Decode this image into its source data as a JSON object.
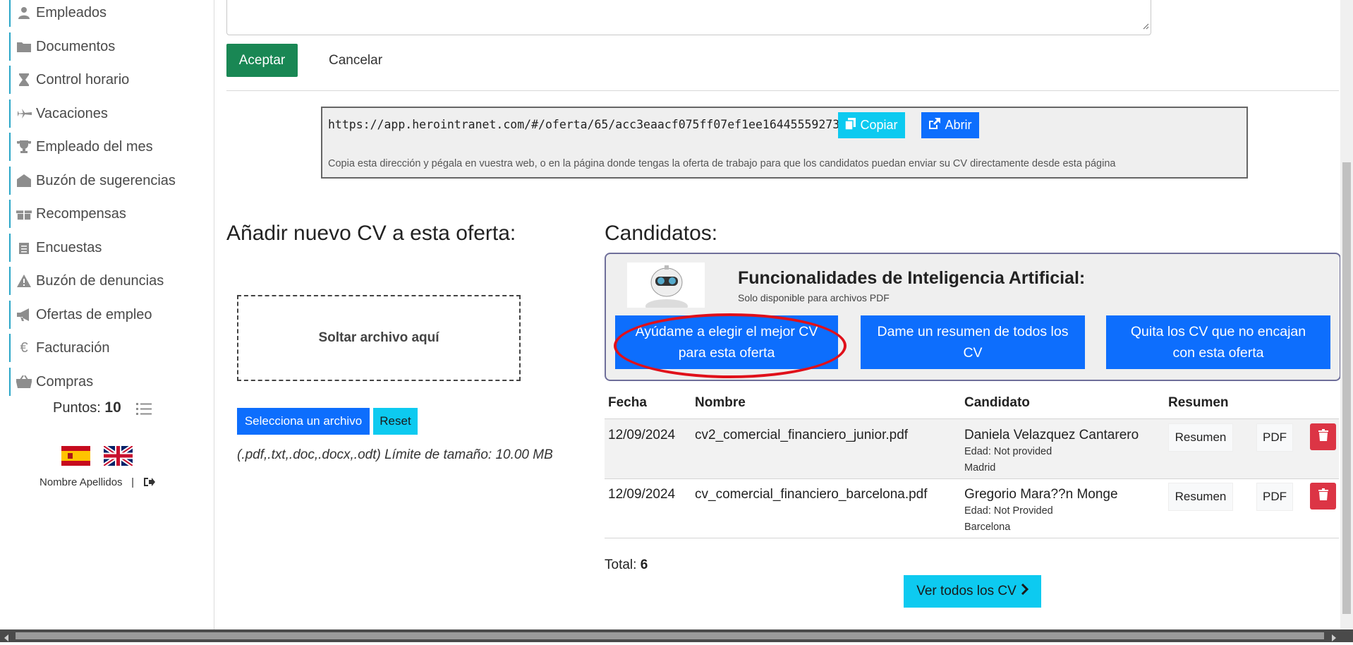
{
  "sidebar": {
    "items": [
      {
        "label": "Empleados",
        "icon": "user-icon"
      },
      {
        "label": "Documentos",
        "icon": "folder-icon"
      },
      {
        "label": "Control horario",
        "icon": "hourglass-icon"
      },
      {
        "label": "Vacaciones",
        "icon": "plane-icon"
      },
      {
        "label": "Empleado del mes",
        "icon": "trophy-icon"
      },
      {
        "label": "Buzón de sugerencias",
        "icon": "envelope-open-icon"
      },
      {
        "label": "Recompensas",
        "icon": "gift-icon"
      },
      {
        "label": "Encuestas",
        "icon": "clipboard-icon"
      },
      {
        "label": "Buzón de denuncias",
        "icon": "warning-icon"
      },
      {
        "label": "Ofertas de empleo",
        "icon": "megaphone-icon"
      },
      {
        "label": "Facturación",
        "icon": "euro-icon"
      },
      {
        "label": "Compras",
        "icon": "basket-icon"
      }
    ],
    "points_label": "Puntos:",
    "points_value": "10",
    "username": "Nombre Apellidos",
    "separator": "|"
  },
  "form": {
    "accept_label": "Aceptar",
    "cancel_label": "Cancelar"
  },
  "share": {
    "url": "https://app.herointranet.com/#/oferta/65/acc3eaacf075ff07ef1ee16445559273",
    "copy_label": "Copiar",
    "open_label": "Abrir",
    "help": "Copia esta dirección y pégala en vuestra web, o en la página donde tengas la oferta de trabajo para que los candidatos puedan enviar su CV directamente desde esta página"
  },
  "upload": {
    "heading": "Añadir nuevo CV a esta oferta:",
    "drop_text": "Soltar archivo aquí",
    "select_label": "Selecciona un archivo",
    "reset_label": "Reset",
    "limits": "(.pdf,.txt,.doc,.docx,.odt) Límite de tamaño: 10.00 MB"
  },
  "candidates": {
    "heading": "Candidatos:",
    "ai": {
      "title": "Funcionalidades de Inteligencia Artificial:",
      "subtitle": "Solo disponible para archivos PDF",
      "btn_best": [
        "Ayúdame a elegir el mejor CV",
        "para esta oferta"
      ],
      "btn_summary": [
        "Dame un resumen de todos los",
        "CV"
      ],
      "btn_filter": [
        "Quita los CV que no encajan",
        "con esta oferta"
      ]
    },
    "columns": {
      "fecha": "Fecha",
      "nombre": "Nombre",
      "candidato": "Candidato",
      "resumen": "Resumen"
    },
    "rows": [
      {
        "fecha": "12/09/2024",
        "nombre": "cv2_comercial_financiero_junior.pdf",
        "candidato": "Daniela Velazquez Cantarero",
        "edad": "Edad: Not provided",
        "ciudad": "Madrid",
        "resumen_label": "Resumen",
        "pdf_label": "PDF"
      },
      {
        "fecha": "12/09/2024",
        "nombre": "cv_comercial_financiero_barcelona.pdf",
        "candidato": "Gregorio Mara??n Monge",
        "edad": "Edad: Not Provided",
        "ciudad": "Barcelona",
        "resumen_label": "Resumen",
        "pdf_label": "PDF"
      }
    ],
    "total_label": "Total:",
    "total_value": "6",
    "view_all_label": "Ver todos los CV"
  },
  "colors": {
    "primary": "#0d6efd",
    "info": "#0dcaf0",
    "success": "#198754",
    "danger": "#dc3545",
    "highlight": "#e0101a",
    "sidebar_accent": "#2aa6c7"
  }
}
